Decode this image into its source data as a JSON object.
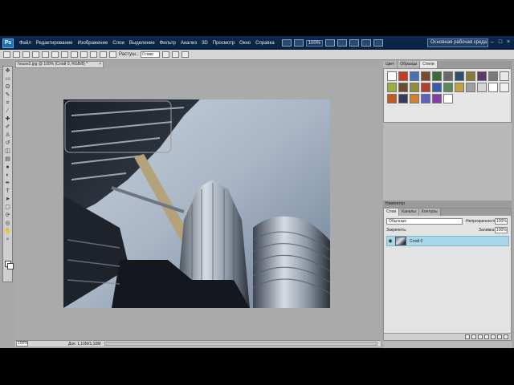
{
  "menu": {
    "logo": "Ps",
    "items": [
      "Файл",
      "Редактирование",
      "Изображение",
      "Слои",
      "Выделение",
      "Фильтр",
      "Анализ",
      "3D",
      "Просмотр",
      "Окно",
      "Справка"
    ],
    "zoom": "100%",
    "workspace": "Основная рабочая среда"
  },
  "options": {
    "feather_label": "Растуш.:",
    "feather_value": "0 пикс"
  },
  "document": {
    "tab_title": "house2.jpg @ 100% (Слой 0, RGB/8) *",
    "zoom": "100%",
    "info": "Док: 1,10M/1,10M"
  },
  "styles_panel": {
    "tabs": [
      "Цвет",
      "Образцы",
      "Стили"
    ],
    "active_tab": "Стили",
    "swatch_colors": [
      "#ffffff",
      "#c23b22",
      "#4a6fb5",
      "#7b4a2a",
      "#3c6b3a",
      "#6a6a6a",
      "#2f4f6f",
      "#8a7a3a",
      "#5a3a6a",
      "#7a7a7a",
      "#e8e8e8",
      "#9ab040",
      "#6d4a2f",
      "#8e8e3c",
      "#b04030",
      "#3a5ab0",
      "#5a8a5a",
      "#c0a040",
      "#a0a0a0",
      "#d6d6d6",
      "#ffffff",
      "#f0f0f0",
      "#c05a20",
      "#3a3a5a",
      "#d08030",
      "#6060c0",
      "#8040a0",
      "#ffffff"
    ]
  },
  "navigator_tab": "Навигатор",
  "layers_panel": {
    "tabs": [
      "Слои",
      "Каналы",
      "Контуры"
    ],
    "active_tab": "Слои",
    "blend_mode": "Обычные",
    "opacity_label": "Непрозрачность:",
    "opacity": "100%",
    "lock_label": "Закрепить:",
    "fill_label": "Заливка:",
    "fill": "100%",
    "layer_name": "Слой 0"
  }
}
